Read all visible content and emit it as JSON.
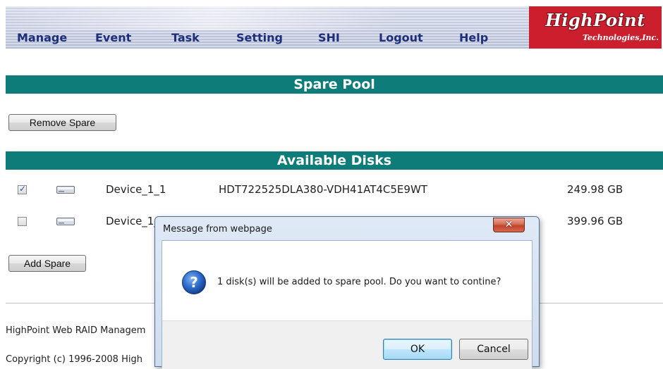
{
  "nav": {
    "items": [
      "Manage",
      "Event",
      "Task",
      "Setting",
      "SHI",
      "Logout",
      "Help"
    ]
  },
  "logo": {
    "name": "HighPoint",
    "sub": "Technologies,Inc."
  },
  "spare_pool": {
    "title": "Spare Pool",
    "remove_button": "Remove Spare"
  },
  "available_disks": {
    "title": "Available Disks",
    "rows": [
      {
        "checked": true,
        "name": "Device_1_1",
        "model": "HDT722525DLA380-VDH41AT4C5E9WT",
        "size": "249.98 GB"
      },
      {
        "checked": false,
        "name": "Device_1_",
        "model": "",
        "size": "399.96 GB"
      }
    ],
    "add_button": "Add Spare"
  },
  "footer": {
    "product": "HighPoint Web RAID Managem",
    "copyright": "Copyright (c) 1996-2008 High"
  },
  "dialog": {
    "title": "Message from webpage",
    "message": "1 disk(s) will be added to spare pool. Do you want to contine?",
    "ok": "OK",
    "cancel": "Cancel"
  },
  "colors": {
    "section_bar": "#0e7c79",
    "nav_text": "#1d2e7a",
    "logo_bg": "#cc1f2e"
  }
}
